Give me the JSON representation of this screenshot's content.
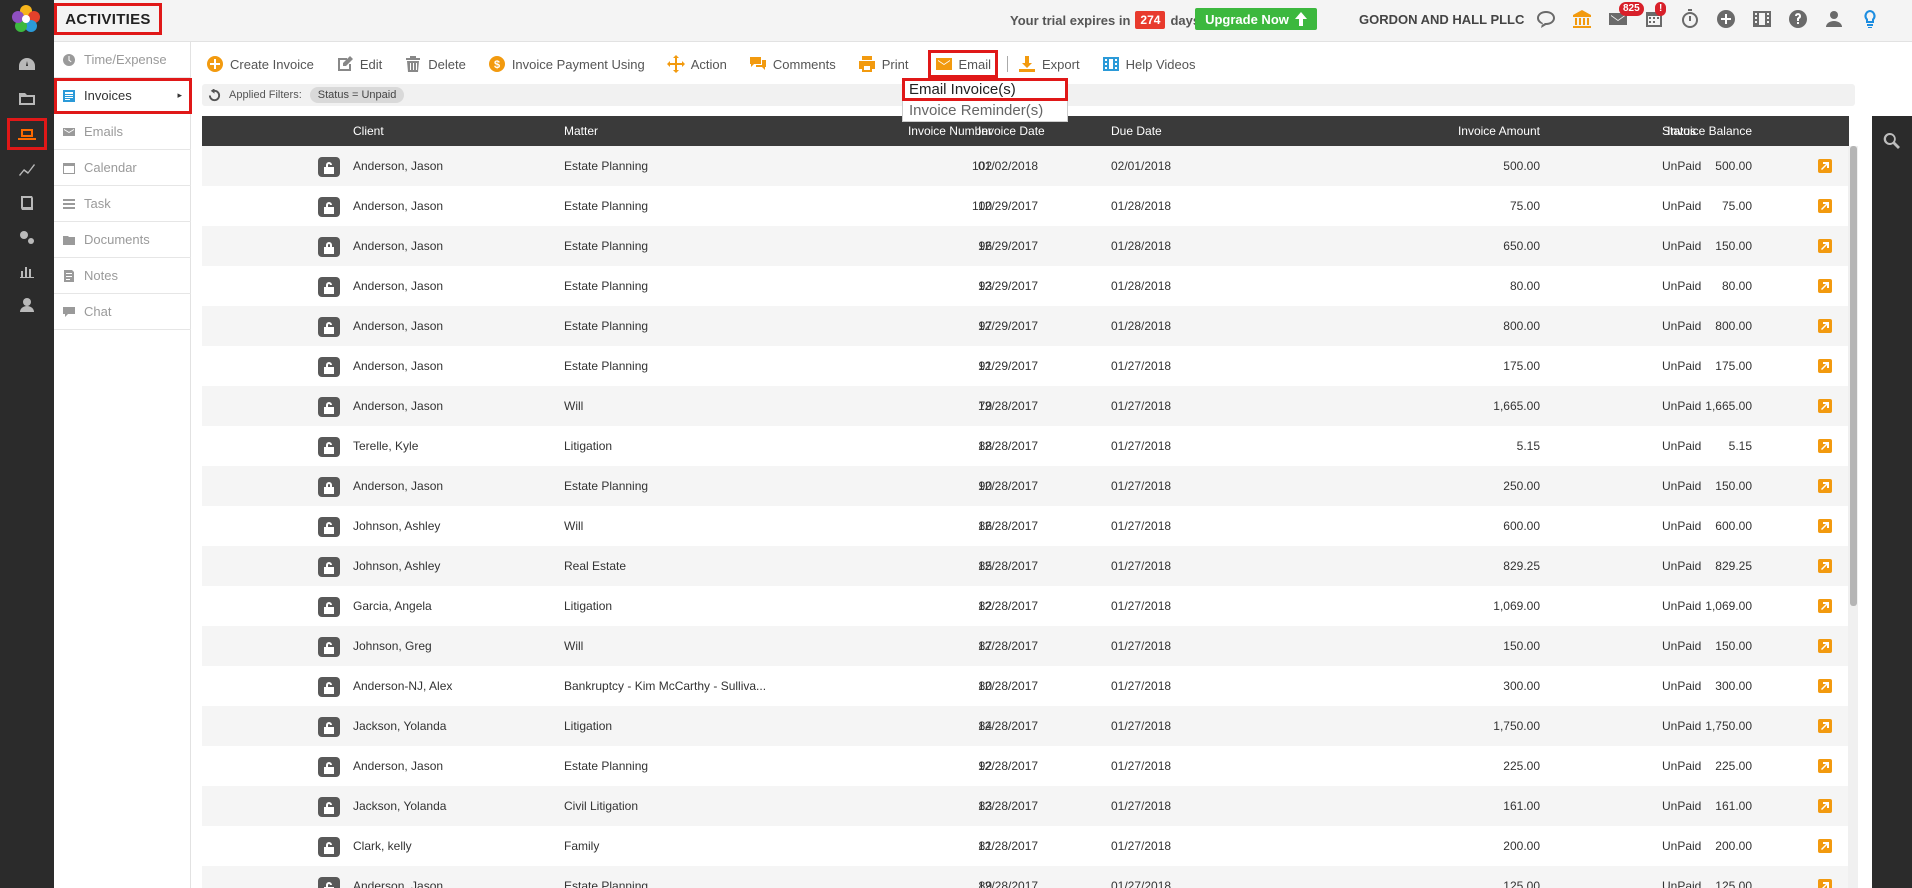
{
  "app": {
    "section_title": "ACTIVITIES",
    "firm_name": "GORDON AND HALL PLLC"
  },
  "trial": {
    "prefix": "Your trial expires in",
    "days": "274",
    "suffix": "days.",
    "upgrade_label": "Upgrade Now"
  },
  "top_icons": [
    {
      "name": "chat-bubble-icon"
    },
    {
      "name": "bank-icon"
    },
    {
      "name": "mail-icon",
      "badge": "825"
    },
    {
      "name": "calendar-grid-icon",
      "badge": "!"
    },
    {
      "name": "stopwatch-icon"
    },
    {
      "name": "plus-circle-icon"
    },
    {
      "name": "film-icon"
    },
    {
      "name": "help-icon"
    },
    {
      "name": "user-icon"
    },
    {
      "name": "lightbulb-icon"
    }
  ],
  "rail": [
    "dashboard-icon",
    "folder-icon",
    "laptop-icon",
    "trend-chart-icon",
    "book-icon",
    "gears-icon",
    "bar-chart-icon",
    "person-icon"
  ],
  "subnav": [
    {
      "label": "Time/Expense",
      "icon": "clock-icon"
    },
    {
      "label": "Invoices",
      "icon": "invoice-icon",
      "active": true
    },
    {
      "label": "Emails",
      "icon": "envelope-icon"
    },
    {
      "label": "Calendar",
      "icon": "calendar-icon"
    },
    {
      "label": "Task",
      "icon": "task-icon"
    },
    {
      "label": "Documents",
      "icon": "folder-icon"
    },
    {
      "label": "Notes",
      "icon": "note-icon"
    },
    {
      "label": "Chat",
      "icon": "chat-icon"
    }
  ],
  "toolbar": {
    "create_invoice": "Create Invoice",
    "edit": "Edit",
    "delete": "Delete",
    "invoice_payment": "Invoice Payment Using",
    "action": "Action",
    "comments": "Comments",
    "print": "Print",
    "email": "Email",
    "export": "Export",
    "help_videos": "Help Videos"
  },
  "email_menu": {
    "email_invoices": "Email Invoice(s)",
    "invoice_reminders": "Invoice Reminder(s)"
  },
  "filters": {
    "label": "Applied Filters:",
    "chip": "Status = Unpaid"
  },
  "table": {
    "headers": {
      "client": "Client",
      "matter": "Matter",
      "number": "Invoice Number",
      "date": "Invoice Date",
      "due": "Due Date",
      "amount": "Invoice Amount",
      "balance": "Invoice Balance",
      "status": "Status"
    },
    "rows": [
      {
        "client": "Anderson, Jason",
        "matter": "Estate Planning",
        "number": "102",
        "date": "01/02/2018",
        "due": "02/01/2018",
        "amount": "500.00",
        "balance": "500.00",
        "status": "UnPaid"
      },
      {
        "client": "Anderson, Jason",
        "matter": "Estate Planning",
        "number": "100",
        "date": "12/29/2017",
        "due": "01/28/2018",
        "amount": "75.00",
        "balance": "75.00",
        "status": "UnPaid"
      },
      {
        "client": "Anderson, Jason",
        "matter": "Estate Planning",
        "number": "96",
        "date": "12/29/2017",
        "due": "01/28/2018",
        "amount": "650.00",
        "balance": "150.00",
        "status": "UnPaid"
      },
      {
        "client": "Anderson, Jason",
        "matter": "Estate Planning",
        "number": "93",
        "date": "12/29/2017",
        "due": "01/28/2018",
        "amount": "80.00",
        "balance": "80.00",
        "status": "UnPaid"
      },
      {
        "client": "Anderson, Jason",
        "matter": "Estate Planning",
        "number": "97",
        "date": "12/29/2017",
        "due": "01/28/2018",
        "amount": "800.00",
        "balance": "800.00",
        "status": "UnPaid"
      },
      {
        "client": "Anderson, Jason",
        "matter": "Estate Planning",
        "number": "91",
        "date": "12/29/2017",
        "due": "01/27/2018",
        "amount": "175.00",
        "balance": "175.00",
        "status": "UnPaid"
      },
      {
        "client": "Anderson, Jason",
        "matter": "Will",
        "number": "79",
        "date": "12/28/2017",
        "due": "01/27/2018",
        "amount": "1,665.00",
        "balance": "1,665.00",
        "status": "UnPaid"
      },
      {
        "client": "Terelle, Kyle",
        "matter": "Litigation",
        "number": "88",
        "date": "12/28/2017",
        "due": "01/27/2018",
        "amount": "5.15",
        "balance": "5.15",
        "status": "UnPaid"
      },
      {
        "client": "Anderson, Jason",
        "matter": "Estate Planning",
        "number": "90",
        "date": "12/28/2017",
        "due": "01/27/2018",
        "amount": "250.00",
        "balance": "150.00",
        "status": "UnPaid"
      },
      {
        "client": "Johnson, Ashley",
        "matter": "Will",
        "number": "86",
        "date": "12/28/2017",
        "due": "01/27/2018",
        "amount": "600.00",
        "balance": "600.00",
        "status": "UnPaid"
      },
      {
        "client": "Johnson, Ashley",
        "matter": "Real Estate",
        "number": "85",
        "date": "12/28/2017",
        "due": "01/27/2018",
        "amount": "829.25",
        "balance": "829.25",
        "status": "UnPaid"
      },
      {
        "client": "Garcia, Angela",
        "matter": "Litigation",
        "number": "82",
        "date": "12/28/2017",
        "due": "01/27/2018",
        "amount": "1,069.00",
        "balance": "1,069.00",
        "status": "UnPaid"
      },
      {
        "client": "Johnson, Greg",
        "matter": "Will",
        "number": "87",
        "date": "12/28/2017",
        "due": "01/27/2018",
        "amount": "150.00",
        "balance": "150.00",
        "status": "UnPaid"
      },
      {
        "client": "Anderson-NJ, Alex",
        "matter": "Bankruptcy - Kim McCarthy - Sulliva...",
        "number": "80",
        "date": "12/28/2017",
        "due": "01/27/2018",
        "amount": "300.00",
        "balance": "300.00",
        "status": "UnPaid"
      },
      {
        "client": "Jackson, Yolanda",
        "matter": "Litigation",
        "number": "84",
        "date": "12/28/2017",
        "due": "01/27/2018",
        "amount": "1,750.00",
        "balance": "1,750.00",
        "status": "UnPaid"
      },
      {
        "client": "Anderson, Jason",
        "matter": "Estate Planning",
        "number": "92",
        "date": "12/28/2017",
        "due": "01/27/2018",
        "amount": "225.00",
        "balance": "225.00",
        "status": "UnPaid"
      },
      {
        "client": "Jackson, Yolanda",
        "matter": "Civil Litigation",
        "number": "83",
        "date": "12/28/2017",
        "due": "01/27/2018",
        "amount": "161.00",
        "balance": "161.00",
        "status": "UnPaid"
      },
      {
        "client": "Clark, kelly",
        "matter": "Family",
        "number": "81",
        "date": "12/28/2017",
        "due": "01/27/2018",
        "amount": "200.00",
        "balance": "200.00",
        "status": "UnPaid"
      },
      {
        "client": "Anderson, Jason",
        "matter": "Estate Planning",
        "number": "89",
        "date": "12/28/2017",
        "due": "01/27/2018",
        "amount": "125.00",
        "balance": "125.00",
        "status": "UnPaid"
      }
    ]
  }
}
